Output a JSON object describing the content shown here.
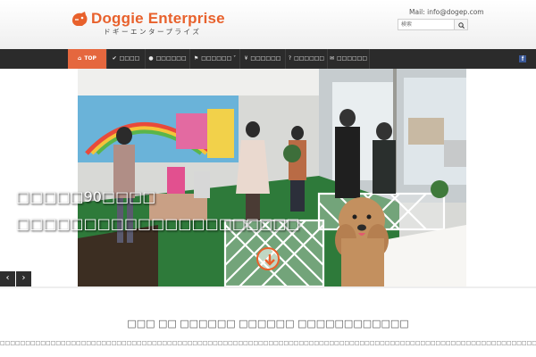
{
  "header": {
    "logo_title": "Doggie Enterprise",
    "logo_subtitle": "ドギーエンタープライズ",
    "contact_email": "Mail: info@dogep.com",
    "search_placeholder": "検索"
  },
  "nav": {
    "items": [
      {
        "label": "TOP",
        "icon": "home-icon"
      },
      {
        "label": "□□□□",
        "icon": "check-icon"
      },
      {
        "label": "□□□□□□",
        "icon": "dog-icon"
      },
      {
        "label": "□□□□□□",
        "icon": "flag-icon",
        "has_dropdown": true
      },
      {
        "label": "□□□□□□",
        "icon": "yen-icon"
      },
      {
        "label": "□□□□□□",
        "icon": "question-icon"
      },
      {
        "label": "□□□□□□",
        "icon": "envelope-icon"
      }
    ],
    "social": "f"
  },
  "hero": {
    "line1": "□□□□□90□□□□",
    "line2": "□□□□□□□□□□□□□□□□□□□□□"
  },
  "slider": {
    "prev_label": "‹",
    "next_label": "›"
  },
  "section": {
    "title": "□□□ □□ □□□□□□ □□□□□□ □□□□□□□□□□□□",
    "text": "□□□□□□□□□□□□□□□□□□□□□□□□□□□□□□□□□□□□□□□□□□□□□□□□□□□□□□□□□□□□□□□□□□□□□□□□□□□□□□□□□□□□□□□□□□□□□□□□□□□□□□□□□□□□□□□□□□□□□□□□□□□□□□"
  },
  "colors": {
    "brand": "#e8612c",
    "nav_bg": "#2b2b2b",
    "nav_active": "#e5673e",
    "facebook": "#3b5998"
  }
}
